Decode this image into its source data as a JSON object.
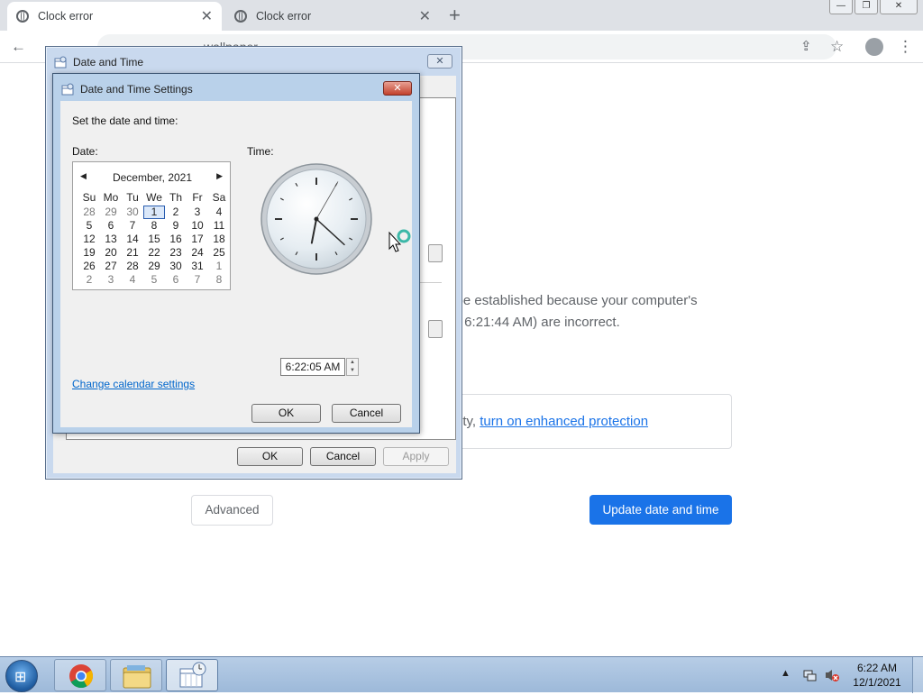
{
  "browser": {
    "tabs": [
      {
        "title": "Clock error",
        "close": "✕"
      },
      {
        "title": "Clock error",
        "close": "✕"
      }
    ],
    "new_tab": "+",
    "address_visible": "wallpaper",
    "window_controls": {
      "minimize": "—",
      "maximize": "❐",
      "close": "✕"
    }
  },
  "page": {
    "text_line1": "n't be established because your computer's",
    "text_line2": "1 at 6:21:44 AM) are incorrect.",
    "info_prefix": "ity, ",
    "info_link": "turn on enhanced protection",
    "advanced_button": "Advanced",
    "update_button": "Update date and time"
  },
  "outer_dialog": {
    "title": "Date and Time",
    "close": "✕",
    "ok": "OK",
    "cancel": "Cancel",
    "apply": "Apply"
  },
  "inner_dialog": {
    "title": "Date and Time Settings",
    "close": "✕",
    "instruction": "Set the date and time:",
    "date_label": "Date:",
    "time_label": "Time:",
    "month_year": "December, 2021",
    "weekdays": [
      "Su",
      "Mo",
      "Tu",
      "We",
      "Th",
      "Fr",
      "Sa"
    ],
    "weeks": [
      [
        "28",
        "29",
        "30",
        "1",
        "2",
        "3",
        "4"
      ],
      [
        "5",
        "6",
        "7",
        "8",
        "9",
        "10",
        "11"
      ],
      [
        "12",
        "13",
        "14",
        "15",
        "16",
        "17",
        "18"
      ],
      [
        "19",
        "20",
        "21",
        "22",
        "23",
        "24",
        "25"
      ],
      [
        "26",
        "27",
        "28",
        "29",
        "30",
        "31",
        "1"
      ],
      [
        "2",
        "3",
        "4",
        "5",
        "6",
        "7",
        "8"
      ]
    ],
    "selected_day": "1",
    "time_value": "6:22:05 AM",
    "clock": {
      "hour": 6,
      "minute": 22,
      "second": 5
    },
    "calendar_link": "Change calendar settings",
    "ok": "OK",
    "cancel": "Cancel"
  },
  "taskbar": {
    "time": "6:22 AM",
    "date": "12/1/2021",
    "tray_arrow": "▲"
  },
  "icons": {
    "back": "←",
    "share": "⇪",
    "star": "☆",
    "menu": "⋮",
    "windows_logo": "⊞"
  }
}
